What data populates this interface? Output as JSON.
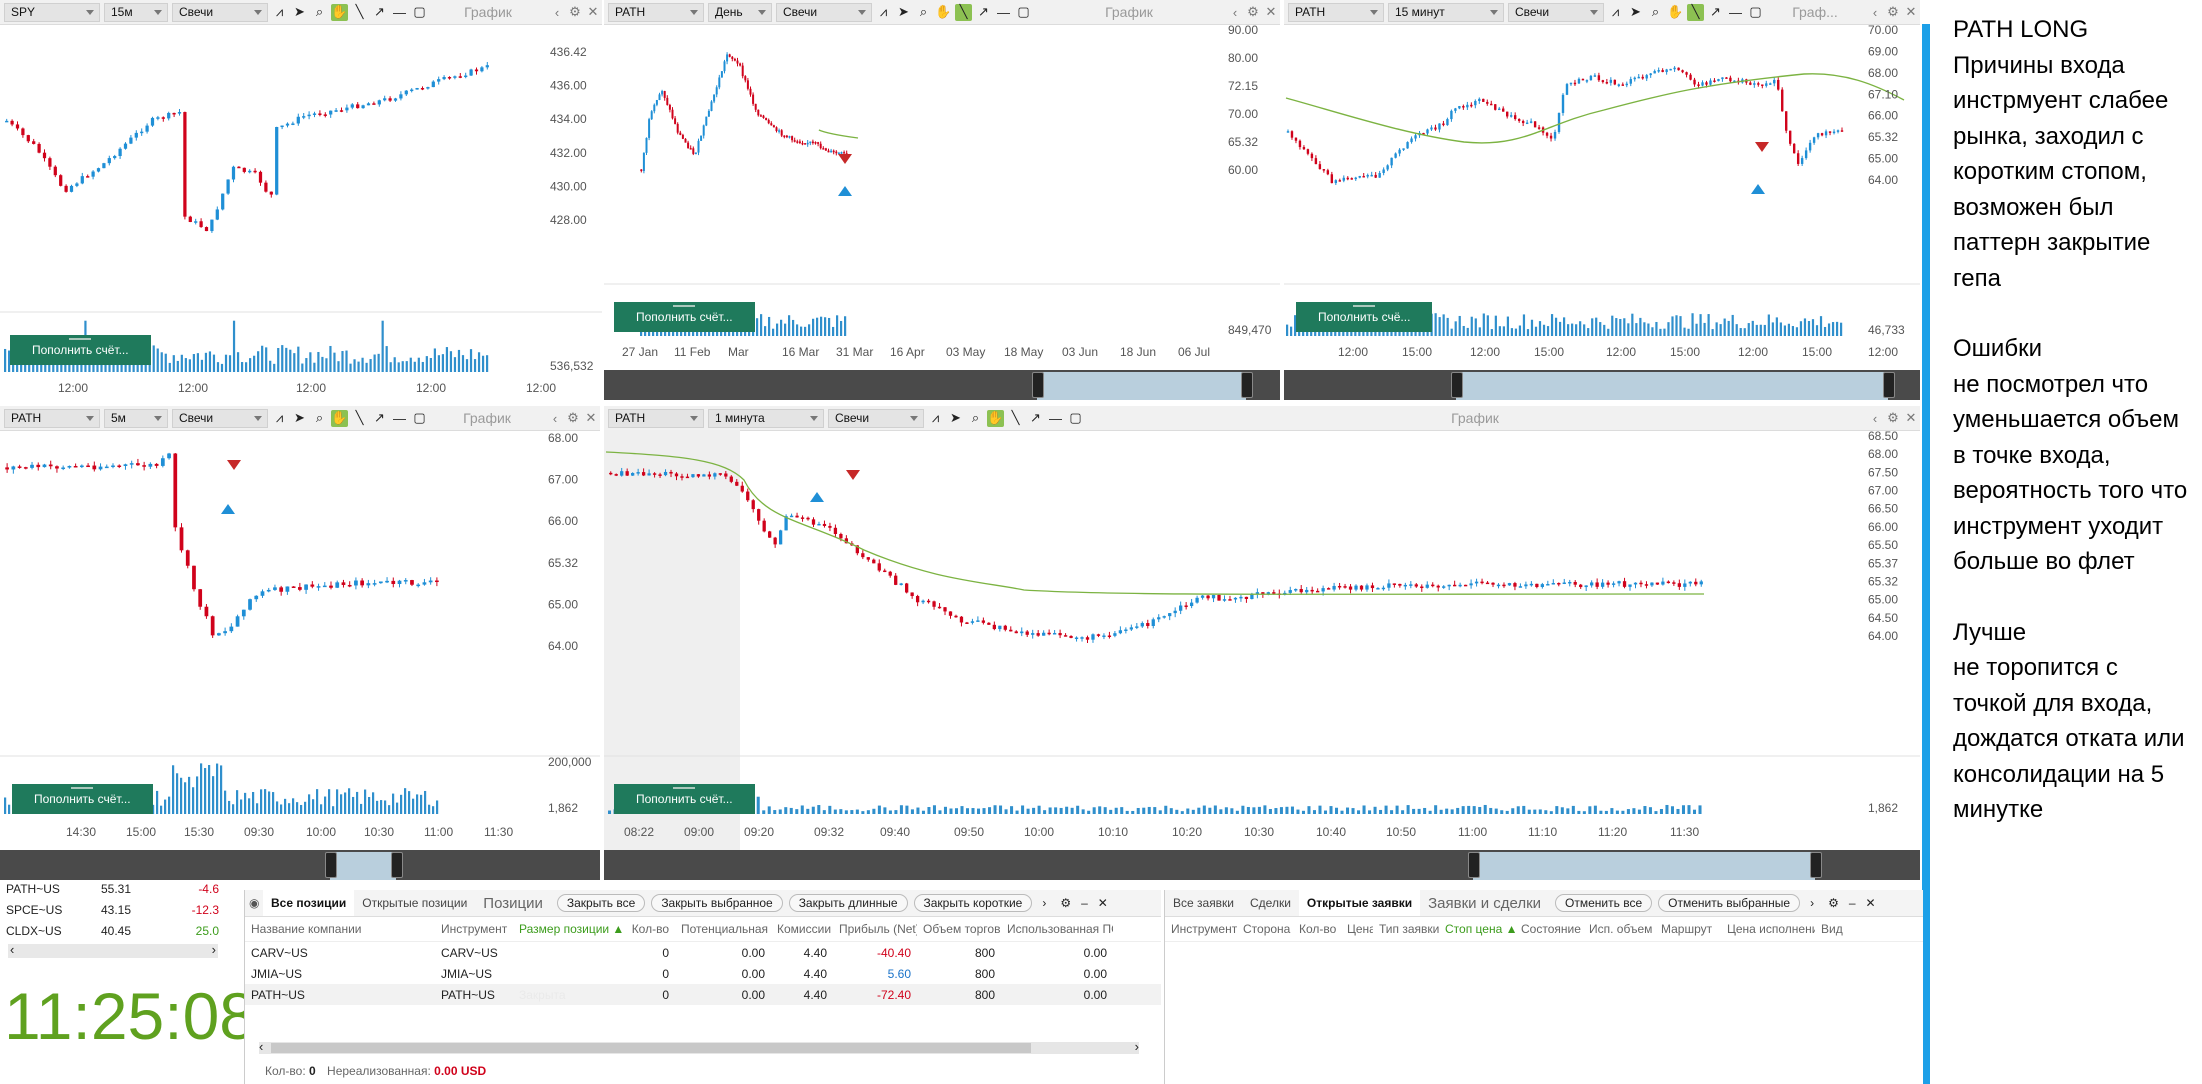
{
  "panels": [
    {
      "id": "p1",
      "symbol": "SPY",
      "timeframe": "15м",
      "style": "Свечи",
      "title": "График",
      "topup": "Пополнить счёт...",
      "price_labels": [
        {
          "v": "436.42",
          "red": true
        },
        {
          "v": "436.00"
        },
        {
          "v": "434.00"
        },
        {
          "v": "432.00"
        },
        {
          "v": "430.00"
        },
        {
          "v": "428.00"
        }
      ],
      "volume_label": "536,532",
      "time_labels": [
        "12:00",
        "12:00",
        "12:00",
        "12:00",
        "12:00"
      ]
    },
    {
      "id": "p2",
      "symbol": "PATH",
      "timeframe": "День",
      "style": "Свечи",
      "title": "График",
      "topup": "Пополнить счёт...",
      "price_labels": [
        {
          "v": "90.00"
        },
        {
          "v": "80.00"
        },
        {
          "v": "72.15",
          "green": true
        },
        {
          "v": "70.00"
        },
        {
          "v": "65.32",
          "red": true
        },
        {
          "v": "60.00"
        }
      ],
      "volume_label": "849,470",
      "time_labels": [
        "27 Jan",
        "11 Feb",
        "Mar",
        "16 Mar",
        "31 Mar",
        "16 Apr",
        "03 May",
        "18 May",
        "03 Jun",
        "18 Jun",
        "06 Jul"
      ]
    },
    {
      "id": "p3",
      "symbol": "PATH",
      "timeframe": "15 минут",
      "style": "Свечи",
      "title": "Граф...",
      "topup": "Пополнить счё...",
      "price_labels": [
        {
          "v": "70.00"
        },
        {
          "v": "69.00"
        },
        {
          "v": "68.00"
        },
        {
          "v": "67.10",
          "green": true
        },
        {
          "v": "66.00"
        },
        {
          "v": "65.32",
          "red": true
        },
        {
          "v": "65.00"
        },
        {
          "v": "64.00"
        }
      ],
      "volume_label": "46,733",
      "time_labels": [
        "12:00",
        "15:00",
        "12:00",
        "15:00",
        "12:00",
        "15:00",
        "12:00",
        "15:00",
        "12:00"
      ]
    },
    {
      "id": "p4",
      "symbol": "PATH",
      "timeframe": "5м",
      "style": "Свечи",
      "title": "График",
      "topup": "Пополнить счёт...",
      "price_labels": [
        {
          "v": "68.00"
        },
        {
          "v": "67.00"
        },
        {
          "v": "66.00"
        },
        {
          "v": "65.32",
          "blue": true
        },
        {
          "v": "65.00"
        },
        {
          "v": "64.00"
        }
      ],
      "volume_label": "1,862",
      "volume_top": "200,000",
      "time_labels": [
        "14:30",
        "15:00",
        "15:30",
        "09:30",
        "10:00",
        "10:30",
        "11:00",
        "11:30"
      ]
    },
    {
      "id": "p5",
      "symbol": "PATH",
      "timeframe": "1 минута",
      "style": "Свечи",
      "title": "График",
      "topup": "Пополнить счёт...",
      "price_labels": [
        {
          "v": "68.50"
        },
        {
          "v": "68.00"
        },
        {
          "v": "67.50"
        },
        {
          "v": "67.00"
        },
        {
          "v": "66.50"
        },
        {
          "v": "66.00"
        },
        {
          "v": "65.50"
        },
        {
          "v": "65.37",
          "green": true
        },
        {
          "v": "65.32",
          "red": true
        },
        {
          "v": "65.00"
        },
        {
          "v": "64.50"
        },
        {
          "v": "64.00"
        }
      ],
      "volume_label": "1,862",
      "time_labels": [
        "08:22",
        "09:00",
        "09:20",
        "09:32",
        "09:40",
        "09:50",
        "10:00",
        "10:10",
        "10:20",
        "10:30",
        "10:40",
        "10:50",
        "11:00",
        "11:10",
        "11:20",
        "11:30"
      ]
    }
  ],
  "watchlist": {
    "rows": [
      {
        "sym": "PATH~US",
        "price": "55.31",
        "chg": "-4.6",
        "neg": true
      },
      {
        "sym": "SPCE~US",
        "price": "43.15",
        "chg": "-12.3",
        "neg": true
      },
      {
        "sym": "CLDX~US",
        "price": "40.45",
        "chg": "25.0",
        "neg": false
      }
    ]
  },
  "clock": "11:25:08",
  "positions": {
    "tabs": [
      "Все позиции",
      "Открытые позиции"
    ],
    "title": "Позиции",
    "buttons": [
      "Закрыть все",
      "Закрыть выбранное",
      "Закрыть длинные",
      "Закрыть короткие"
    ],
    "columns": [
      "Название компании",
      "Инструмент",
      "Размер позиции ▲",
      "Кол-во",
      "Потенциальная",
      "Комиссии",
      "Прибыль (Net)",
      "Объем торгов",
      "Использованная ПС"
    ],
    "rows": [
      {
        "name": "CARV~US",
        "instr": "CARV~US",
        "size": "",
        "qty": "0",
        "potential": "0.00",
        "fee": "4.40",
        "pnl": "-40.40",
        "sign": "neg",
        "vol": "800",
        "used": "0.00"
      },
      {
        "name": "JMIA~US",
        "instr": "JMIA~US",
        "size": "",
        "qty": "0",
        "potential": "0.00",
        "fee": "4.40",
        "pnl": "5.60",
        "sign": "pos",
        "vol": "800",
        "used": "0.00"
      },
      {
        "name": "PATH~US",
        "instr": "PATH~US",
        "size": "Закрыта",
        "qty": "0",
        "potential": "0.00",
        "fee": "4.40",
        "pnl": "-72.40",
        "sign": "neg",
        "vol": "800",
        "used": "0.00"
      }
    ],
    "footer_qty_label": "Кол-во:",
    "footer_qty": "0",
    "footer_unreal_label": "Нереализованная:",
    "footer_unreal": "0.00 USD"
  },
  "orders": {
    "tabs": [
      "Все заявки",
      "Сделки",
      "Открытые заявки"
    ],
    "title": "Заявки и сделки",
    "buttons": [
      "Отменить все",
      "Отменить выбранные"
    ],
    "columns": [
      "Инструмент",
      "Сторона",
      "Кол-во",
      "Цена",
      "Тип заявки",
      "Стоп цена ▲",
      "Состояние",
      "Исп. объем",
      "Маршрут",
      "Цена исполнения",
      "Вид"
    ]
  },
  "notes": [
    "PATH LONG",
    "Причины входа инстрмуент слабее рынка, заходил с коротким стопом, возможен был паттерн закрытие гепа",
    "",
    "Ошибки",
    "не посмотрел что уменьшается объем в точке входа, вероятность того что инструмент уходит больше во флет",
    "",
    "Лучше",
    "не торопится с точкой для входа, дождатся отката или консолидации на 5 минутке"
  ],
  "colors": {
    "up": "#1f8fd6",
    "down": "#d0021b",
    "ma": "#7cb342",
    "volume": "#2f8fcc",
    "accent": "#1ca0e8",
    "topup": "#1f7a5c",
    "clock": "#5fa11f"
  }
}
